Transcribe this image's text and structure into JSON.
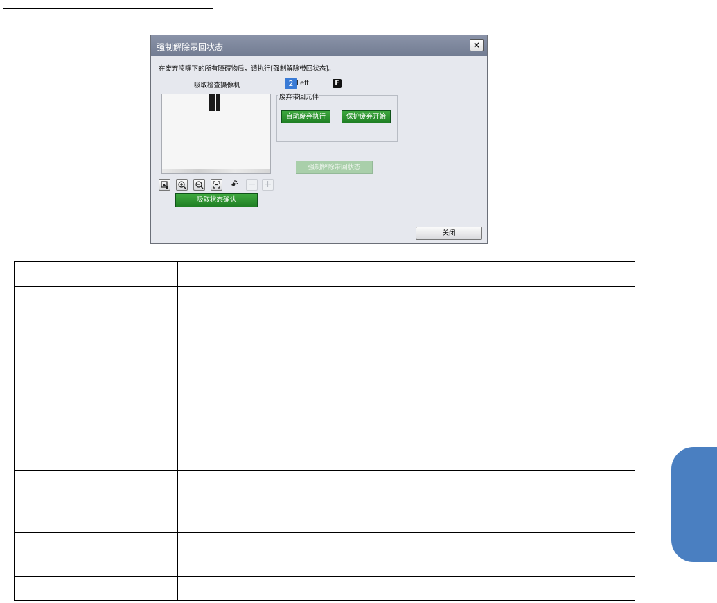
{
  "dialog": {
    "title": "强制解除带回状态",
    "close_glyph": "×",
    "instruction": "在废弃喷嘴下的所有障碍物后，请执行[强制解除带回状态]。",
    "camera_label": "吸取检查摄像机",
    "nozzle_number": "2",
    "nozzle_side": "Left",
    "f_badge": "F",
    "toolbar": {
      "tools": [
        "image-select-icon",
        "zoom-in-icon",
        "zoom-out-icon",
        "fit-icon",
        "light-icon",
        "minus-icon",
        "plus-icon"
      ],
      "minus_glyph": "−",
      "plus_glyph": "+"
    },
    "confirm_button": "吸取状态确认",
    "group_title": "废弃带回元件",
    "auto_discard_button": "自动废弃执行",
    "protect_discard_button": "保护废弃开始",
    "force_release_button": "强制解除带回状态",
    "close_button": "关闭"
  },
  "table": {
    "rows": [
      [
        "",
        "",
        ""
      ],
      [
        "",
        "",
        ""
      ],
      [
        "",
        "",
        ""
      ],
      [
        "",
        "",
        ""
      ],
      [
        "",
        "",
        ""
      ],
      [
        "",
        "",
        ""
      ]
    ]
  },
  "colors": {
    "titlebar": "#7f889c",
    "green_button": "#2e8f32",
    "side_tab": "#4a7fc1",
    "nozzle_badge": "#3a7bd6"
  }
}
